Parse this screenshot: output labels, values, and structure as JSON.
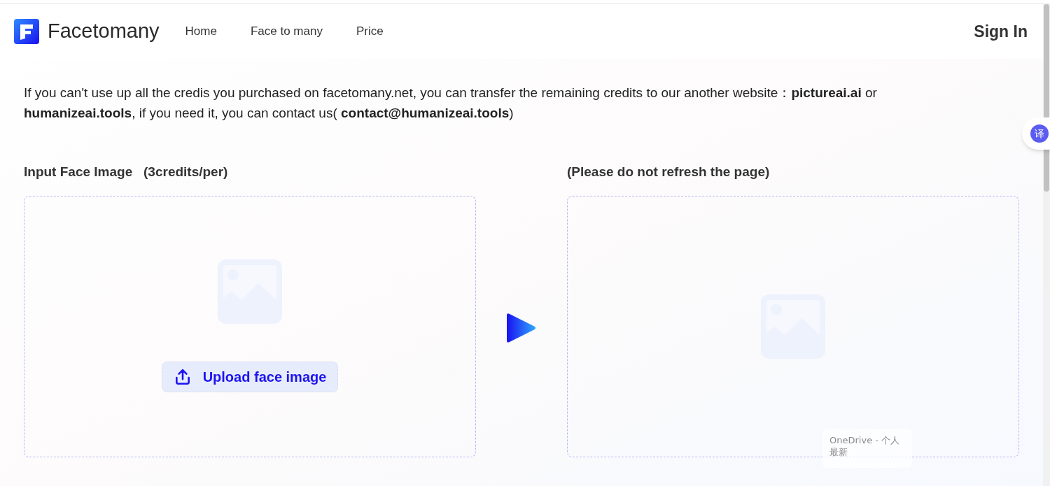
{
  "header": {
    "brand": "Facetomany",
    "nav": [
      "Home",
      "Face to many",
      "Price"
    ],
    "sign_in": "Sign In"
  },
  "notice": "If you can't use up all the credis you purchased on facetomany.net, you can transfer the remaining credits to our another website：**pictureai.ai**  or  **humanizeai.tools**, if you need it, you can contact us( **contact@humanizeai.tools**)",
  "translate_badge": "译",
  "input_panel": {
    "title": "Input Face Image   (3credits/per)",
    "upload_button": "Upload face image"
  },
  "output_panel": {
    "title": "(Please do not refresh the page)"
  },
  "toast": {
    "title": "OneDrive - 个人",
    "subtitle": "最新"
  }
}
